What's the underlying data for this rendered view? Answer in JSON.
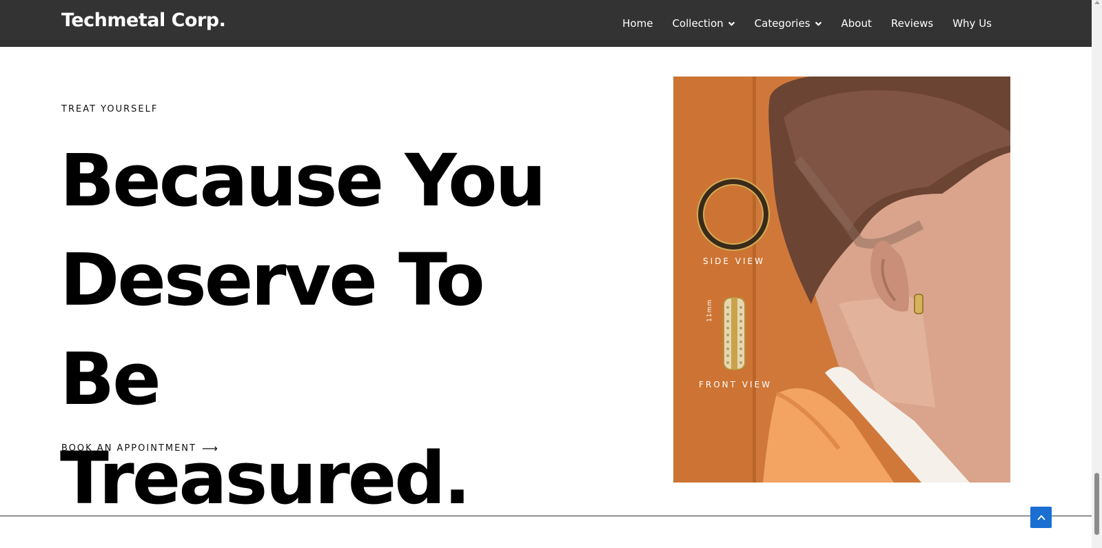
{
  "header": {
    "brand": "Techmetal Corp.",
    "nav": [
      {
        "label": "Home",
        "has_dropdown": false
      },
      {
        "label": "Collection",
        "has_dropdown": true
      },
      {
        "label": "Categories",
        "has_dropdown": true
      },
      {
        "label": "About",
        "has_dropdown": false
      },
      {
        "label": "Reviews",
        "has_dropdown": false
      },
      {
        "label": "Why Us",
        "has_dropdown": false
      }
    ]
  },
  "hero": {
    "eyebrow": "TREAT YOURSELF",
    "headline_lines": [
      "Because You",
      "Deserve To Be",
      "Treasured."
    ],
    "cta_label": "BOOK AN APPOINTMENT",
    "cta_icon": "arrow-right-icon"
  },
  "promo_image": {
    "side_view_label": "SIDE VIEW",
    "front_view_label": "FRONT VIEW",
    "size_label": "11mm",
    "background_color": "#d0783a"
  },
  "back_to_top": {
    "icon": "chevron-up-icon",
    "color": "#1a6fd1"
  },
  "colors": {
    "header_bg": "#333333",
    "text": "#000000"
  }
}
